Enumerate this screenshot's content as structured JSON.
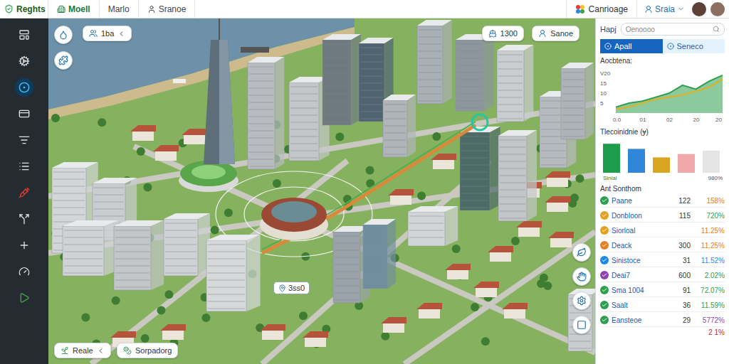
{
  "topbar": {
    "logo": "Reghts",
    "tabs": [
      {
        "label": "Moell",
        "selected": true
      },
      {
        "label": "Marlo",
        "selected": false
      },
      {
        "label": "Sranoe",
        "selected": false
      }
    ],
    "brand": "Canrioage",
    "user": "Sraia"
  },
  "sidebar": {
    "items": [
      {
        "selected": false
      },
      {
        "selected": false
      },
      {
        "selected": true
      },
      {
        "selected": false
      },
      {
        "selected": false
      },
      {
        "selected": false
      },
      {
        "selected": false
      },
      {
        "selected": false
      },
      {
        "selected": false
      },
      {
        "selected": false
      },
      {
        "selected": false
      }
    ]
  },
  "map": {
    "top_left": "1ba",
    "top_right": [
      "1300",
      "Sanoe"
    ],
    "bottom_left": [
      "Reale",
      "Sorpadorg"
    ],
    "marker": "3ss0"
  },
  "panel": {
    "title": "Hapj",
    "search": {
      "placeholder": "Oenoooo"
    },
    "tabs": [
      {
        "label": "Apall",
        "selected": true
      },
      {
        "label": "Seneco",
        "selected": false
      }
    ],
    "line_chart": {
      "title": "Aocbtena:",
      "y_ticks": [
        "V20",
        "15",
        "10",
        "5"
      ],
      "x_ticks": [
        "0.0",
        "01",
        "02",
        "20",
        "20"
      ],
      "series": [
        {
          "values": [
            3,
            5,
            6,
            8,
            10,
            14,
            12,
            16,
            19
          ],
          "color": "#2e9e4f"
        },
        {
          "values": [
            2,
            3,
            5,
            7,
            8,
            9,
            11,
            13,
            17
          ],
          "color": "#e0b020"
        }
      ]
    },
    "bar_chart": {
      "title": "Tlecoinidnie (ɏ)",
      "bars": [
        {
          "value": 17,
          "color": "#1e9e4a"
        },
        {
          "value": 14,
          "color": "#2f86d8"
        },
        {
          "value": 9,
          "color": "#d9a520"
        },
        {
          "value": 11,
          "color": "#f0a8a8"
        },
        {
          "value": 13,
          "color": "#e4e4e4"
        }
      ],
      "labels": [
        "Sinial",
        "980%"
      ]
    },
    "list": {
      "title": "Ant Sonthom",
      "items": [
        {
          "name": "Paane",
          "count": "122",
          "pct": "158%",
          "color": "#2e9e4f",
          "pct_color": "#e67e22"
        },
        {
          "name": "Donbloon",
          "count": "115",
          "pct": "720%",
          "color": "#e6a020",
          "pct_color": "#2e9e4f"
        },
        {
          "name": "Siorloal",
          "pct": "11.25%",
          "color": "#e6a020",
          "pct_color": "#e67e22"
        },
        {
          "name": "Deack",
          "count": "300",
          "pct": "11.25%",
          "color": "#e67e22",
          "pct_color": "#e67e22"
        },
        {
          "name": "Sinistoce",
          "count": "31",
          "pct": "11.52%",
          "color": "#1e88e5",
          "pct_color": "#1e88e5"
        },
        {
          "name": "Deai7",
          "count": "600",
          "pct": "2.02%",
          "color": "#8e44ad",
          "pct_color": "#2e9e4f"
        },
        {
          "name": "Sma 1004",
          "count": "91",
          "pct": "72.07%",
          "color": "#2e9e4f",
          "pct_color": "#2e9e4f"
        },
        {
          "name": "Saalt",
          "count": "36",
          "pct": "11.59%",
          "color": "#2e9e4f",
          "pct_color": "#2e9e4f"
        },
        {
          "name": "Eansteoe",
          "count": "29",
          "pct": "5772%",
          "color": "#2e9e4f",
          "pct_color": "#8e44ad"
        }
      ],
      "footer": "2 1%"
    }
  }
}
